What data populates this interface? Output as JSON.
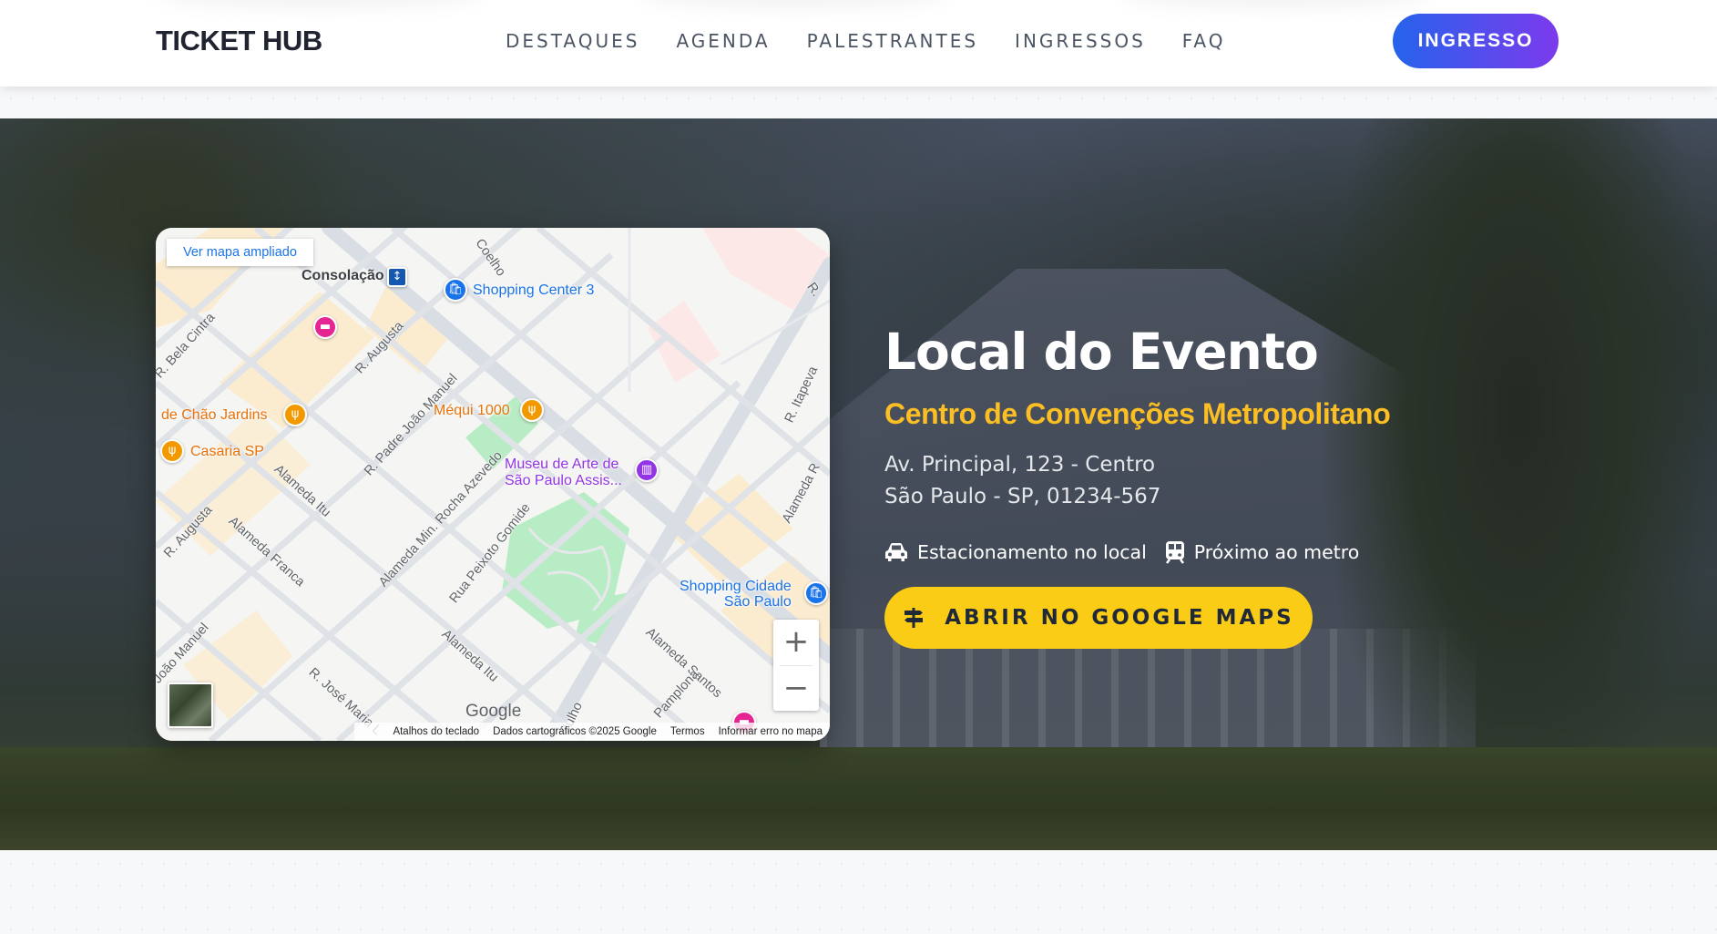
{
  "header": {
    "logo": "TICKET HUB",
    "nav": [
      "DESTAQUES",
      "AGENDA",
      "PALESTRANTES",
      "INGRESSOS",
      "FAQ"
    ],
    "cta_label": "INGRESSO",
    "cta_gradient": [
      "#2563eb",
      "#7c3aed"
    ]
  },
  "map": {
    "view_larger_label": "Ver mapa ampliado",
    "places": {
      "consolacao": "Consolação",
      "shopping_center_3": "Shopping Center 3",
      "chao_jardins": "de Chão Jardins",
      "mequi": "Méqui 1000",
      "casaria": "Casaria SP",
      "museu_line1": "Museu de Arte de",
      "museu_line2": "São Paulo Assis...",
      "shopping_cidade_line1": "Shopping Cidade",
      "shopping_cidade_line2": "São Paulo"
    },
    "streets": {
      "bela_cintra": "R. Bela Cintra",
      "augusta_top": "R. Augusta",
      "padre_joao": "R. Padre João Manuel",
      "azevedo": "Alameda Min. Rocha Azevedo",
      "peixoto": "Rua Peixoto Gomide",
      "itu_left": "Alameda Itu",
      "franca": "Alameda Franca",
      "augusta_bottom": "R. Augusta",
      "itu_bottom": "Alameda Itu",
      "jose_maria": "R. José Maria L",
      "joao_manuel": "João Manuel",
      "santos": "Alameda Santos",
      "pamplona": "Pamplona",
      "julho": "Julho",
      "itapeva": "R. Itapeva",
      "alameda_r": "Alameda R",
      "coelho": "Coelho",
      "r_top": "R."
    },
    "google_logo": "Google",
    "footer": [
      "Atalhos do teclado",
      "Dados cartográficos ©2025 Google",
      "Termos",
      "Informar erro no mapa"
    ],
    "zoom_in": "+",
    "zoom_out": "−"
  },
  "venue": {
    "title": "Local do Evento",
    "name": "Centro de Convenções Metropolitano",
    "address_line1": "Av. Principal, 123 - Centro",
    "address_line2": "São Paulo - SP, 01234-567",
    "features": [
      {
        "icon": "car-icon",
        "label": "Estacionamento no local"
      },
      {
        "icon": "train-icon",
        "label": "Próximo ao metro"
      }
    ],
    "cta_label": "ABRIR NO GOOGLE MAPS",
    "cta_icon": "directions-sign-icon",
    "accent_color": "#fbbf24"
  }
}
